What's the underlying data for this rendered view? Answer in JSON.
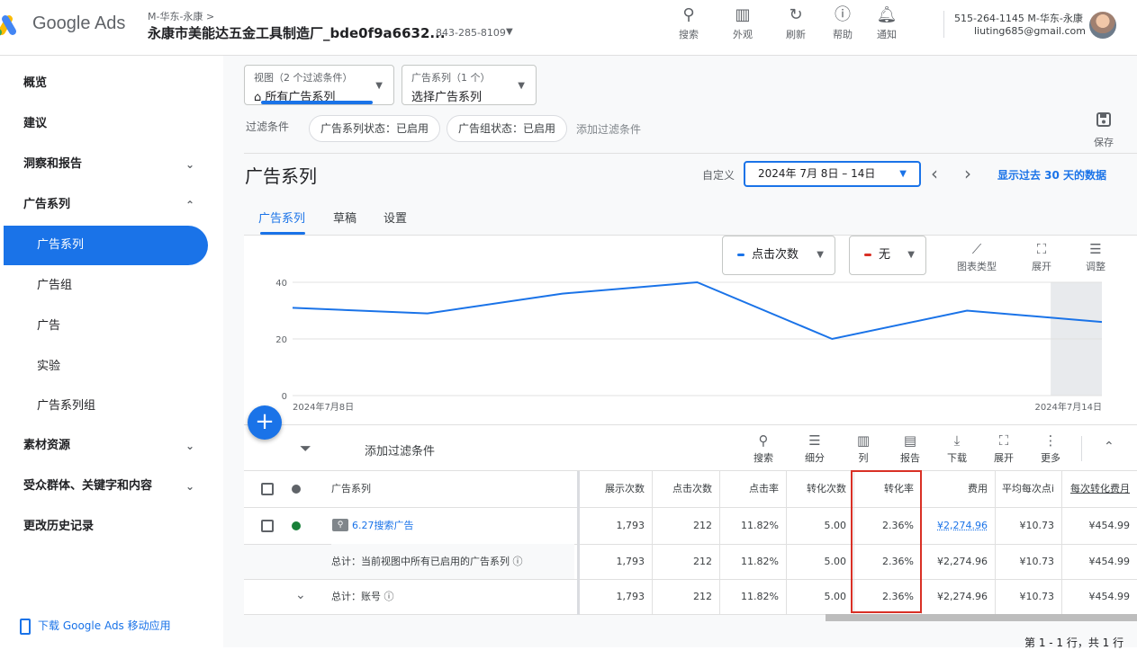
{
  "brand": {
    "product": "Google Ads"
  },
  "account": {
    "crumb": "M-华东-永康",
    "crumb_chevron": ">",
    "name": "永康市美能达五金工具制造厂_bde0f9a6632...",
    "id": "843-285-8109"
  },
  "header_actions": [
    {
      "label": "搜索",
      "icon": "search-icon"
    },
    {
      "label": "外观",
      "icon": "appearance-icon"
    },
    {
      "label": "刷新",
      "icon": "refresh-icon"
    },
    {
      "label": "帮助",
      "icon": "help-icon"
    },
    {
      "label": "通知",
      "icon": "bell-icon"
    }
  ],
  "user": {
    "line1": "515-264-1145 M-华东-永康",
    "email": "liuting685@gmail.com"
  },
  "sidebar": {
    "items": [
      {
        "label": "概览"
      },
      {
        "label": "建议"
      },
      {
        "label": "洞察和报告",
        "expand": "⌄"
      },
      {
        "label": "广告系列",
        "expand": "⌃"
      },
      {
        "label": "广告系列",
        "active": true
      },
      {
        "label": "广告组"
      },
      {
        "label": "广告"
      },
      {
        "label": "实验"
      },
      {
        "label": "广告系列组"
      },
      {
        "label": "素材资源",
        "expand": "⌄"
      },
      {
        "label": "受众群体、关键字和内容",
        "expand": "⌄"
      },
      {
        "label": "更改历史记录"
      }
    ],
    "app_link": "下载 Google Ads 移动应用"
  },
  "view_selector": {
    "small": "视图（2 个过滤条件）",
    "value": "所有广告系列"
  },
  "campaign_selector": {
    "small": "广告系列（1 个）",
    "value": "选择广告系列"
  },
  "filters": {
    "label": "过滤条件",
    "chips": [
      "广告系列状态：已启用",
      "广告组状态：已启用"
    ],
    "add": "添加过滤条件",
    "save": "保存"
  },
  "page": {
    "title": "广告系列"
  },
  "date": {
    "prefix": "自定义",
    "range": "2024年 7月 8日 – 14日",
    "show_30": "显示过去 30 天的数据"
  },
  "tabs": [
    "广告系列",
    "草稿",
    "设置"
  ],
  "chart_controls": {
    "metric1": {
      "label": "点击次数",
      "color": "#1a73e8"
    },
    "metric2": {
      "label": "无",
      "color": "#d93025"
    },
    "tools": [
      {
        "label": "图表类型",
        "icon": "chart-type-icon"
      },
      {
        "label": "展开",
        "icon": "expand-icon"
      },
      {
        "label": "调整",
        "icon": "tune-icon"
      }
    ]
  },
  "chart_data": {
    "type": "line",
    "x": [
      "2024年7月8日",
      "2024年7月9日",
      "2024年7月10日",
      "2024年7月11日",
      "2024年7月12日",
      "2024年7月13日",
      "2024年7月14日"
    ],
    "x_tick_labels": [
      "2024年7月8日",
      "2024年7月14日"
    ],
    "series": [
      {
        "name": "点击次数",
        "values": [
          31,
          29,
          36,
          40,
          20,
          30,
          26
        ],
        "color": "#1a73e8"
      }
    ],
    "y_ticks": [
      0,
      20,
      40
    ],
    "ylim": [
      0,
      40
    ],
    "grid": true,
    "shaded_last_day": true
  },
  "table_toolbar": {
    "add_filter": "添加过滤条件",
    "tools": [
      {
        "label": "搜索",
        "icon": "search-icon"
      },
      {
        "label": "细分",
        "icon": "segment-icon"
      },
      {
        "label": "列",
        "icon": "columns-icon"
      },
      {
        "label": "报告",
        "icon": "report-icon"
      },
      {
        "label": "下载",
        "icon": "download-icon"
      },
      {
        "label": "展开",
        "icon": "expand-icon"
      },
      {
        "label": "更多",
        "icon": "more-icon"
      }
    ]
  },
  "table": {
    "headers": [
      "广告系列",
      "展示次数",
      "点击次数",
      "点击率",
      "转化次数",
      "转化率",
      "费用",
      "平均每次点i",
      "每次转化费月"
    ],
    "rows": [
      {
        "campaign": "6.27搜索广告",
        "values": [
          "1,793",
          "212",
          "11.82%",
          "5.00",
          "2.36%",
          "¥2,274.96",
          "¥10.73",
          "¥454.99"
        ]
      }
    ],
    "totals": [
      {
        "label": "总计：当前视图中所有已启用的广告系列",
        "values": [
          "1,793",
          "212",
          "11.82%",
          "5.00",
          "2.36%",
          "¥2,274.96",
          "¥10.73",
          "¥454.99"
        ]
      },
      {
        "label": "总计：账号",
        "values": [
          "1,793",
          "212",
          "11.82%",
          "5.00",
          "2.36%",
          "¥2,274.96",
          "¥10.73",
          "¥454.99"
        ]
      }
    ]
  },
  "pagination": "第 1 - 1 行，共 1 行",
  "colors": {
    "accent": "#1a73e8",
    "highlight": "#d93025",
    "enabled": "#188038"
  }
}
